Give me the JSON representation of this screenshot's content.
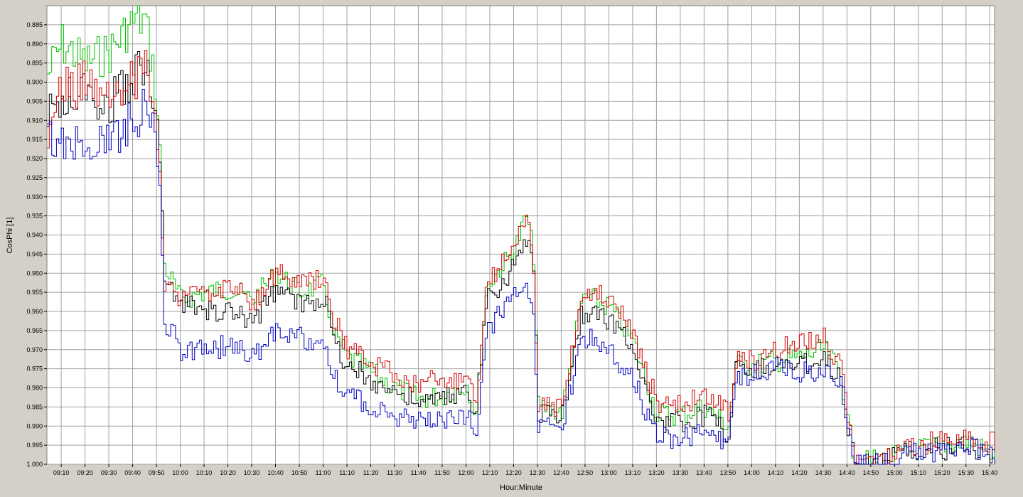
{
  "chart_data": {
    "type": "line",
    "xlabel": "Hour:Minute",
    "ylabel": "CosPhi [1]",
    "xlim": [
      "09:04",
      "15:42"
    ],
    "ylim": [
      0.88,
      1.0
    ],
    "y_reversed": true,
    "grid": true,
    "x_ticks": [
      "09:10",
      "09:20",
      "09:30",
      "09:40",
      "09:50",
      "10:00",
      "10:10",
      "10:20",
      "10:30",
      "10:40",
      "10:50",
      "11:00",
      "11:10",
      "11:20",
      "11:30",
      "11:40",
      "11:50",
      "12:00",
      "12:10",
      "12:20",
      "12:30",
      "12:40",
      "12:50",
      "13:00",
      "13:10",
      "13:20",
      "13:30",
      "13:40",
      "13:50",
      "14:00",
      "14:10",
      "14:20",
      "14:30",
      "14:40",
      "14:50",
      "15:00",
      "15:10",
      "15:20",
      "15:30",
      "15:40"
    ],
    "y_ticks": [
      "0.885",
      "0.890",
      "0.895",
      "0.900",
      "0.905",
      "0.910",
      "0.915",
      "0.920",
      "0.925",
      "0.930",
      "0.935",
      "0.940",
      "0.945",
      "0.950",
      "0.955",
      "0.960",
      "0.965",
      "0.970",
      "0.975",
      "0.980",
      "0.985",
      "0.990",
      "0.995",
      "1.000"
    ],
    "y_tick_values": [
      0.885,
      0.89,
      0.895,
      0.9,
      0.905,
      0.91,
      0.915,
      0.92,
      0.925,
      0.93,
      0.935,
      0.94,
      0.945,
      0.95,
      0.955,
      0.96,
      0.965,
      0.97,
      0.975,
      0.98,
      0.985,
      0.99,
      0.995,
      1.0
    ],
    "x": [
      "09:04",
      "09:10",
      "09:20",
      "09:30",
      "09:40",
      "09:45",
      "09:49",
      "09:51",
      "09:53",
      "10:00",
      "10:10",
      "10:20",
      "10:30",
      "10:40",
      "10:50",
      "11:00",
      "11:04",
      "11:10",
      "11:20",
      "11:30",
      "11:40",
      "11:50",
      "12:00",
      "12:04",
      "12:08",
      "12:10",
      "12:20",
      "12:25",
      "12:28",
      "12:30",
      "12:40",
      "12:48",
      "12:50",
      "13:00",
      "13:10",
      "13:20",
      "13:30",
      "13:40",
      "13:50",
      "13:53",
      "14:00",
      "14:10",
      "14:20",
      "14:30",
      "14:37",
      "14:40",
      "14:43",
      "14:50",
      "15:00",
      "15:10",
      "15:20",
      "15:30",
      "15:40",
      "15:42"
    ],
    "series": [
      {
        "color": "#00c000",
        "values": [
          0.898,
          0.89,
          0.895,
          0.892,
          0.884,
          0.884,
          0.9,
          0.918,
          0.948,
          0.957,
          0.955,
          0.954,
          0.957,
          0.95,
          0.955,
          0.953,
          0.966,
          0.972,
          0.976,
          0.98,
          0.983,
          0.982,
          0.979,
          0.987,
          0.955,
          0.952,
          0.944,
          0.935,
          0.945,
          0.985,
          0.986,
          0.958,
          0.956,
          0.959,
          0.968,
          0.987,
          0.987,
          0.985,
          0.99,
          0.974,
          0.974,
          0.973,
          0.972,
          0.97,
          0.976,
          0.989,
          1.0,
          0.999,
          0.998,
          0.996,
          0.995,
          0.994,
          0.997,
          0.997
        ]
      },
      {
        "color": "#000000",
        "values": [
          0.909,
          0.905,
          0.902,
          0.906,
          0.898,
          0.895,
          0.905,
          0.918,
          0.952,
          0.958,
          0.96,
          0.96,
          0.963,
          0.954,
          0.958,
          0.956,
          0.968,
          0.974,
          0.978,
          0.981,
          0.984,
          0.983,
          0.981,
          0.986,
          0.958,
          0.956,
          0.948,
          0.94,
          0.95,
          0.986,
          0.987,
          0.961,
          0.96,
          0.962,
          0.969,
          0.99,
          0.989,
          0.987,
          0.992,
          0.975,
          0.975,
          0.974,
          0.974,
          0.972,
          0.977,
          0.99,
          1.0,
          0.999,
          0.998,
          0.996,
          0.996,
          0.995,
          0.997,
          0.997
        ]
      },
      {
        "color": "#d00000",
        "values": [
          0.912,
          0.902,
          0.9,
          0.903,
          0.9,
          0.897,
          0.908,
          0.922,
          0.954,
          0.956,
          0.956,
          0.953,
          0.958,
          0.95,
          0.953,
          0.952,
          0.962,
          0.97,
          0.974,
          0.976,
          0.979,
          0.978,
          0.977,
          0.983,
          0.952,
          0.951,
          0.944,
          0.935,
          0.948,
          0.984,
          0.985,
          0.956,
          0.955,
          0.957,
          0.966,
          0.984,
          0.985,
          0.982,
          0.986,
          0.972,
          0.973,
          0.97,
          0.969,
          0.967,
          0.975,
          0.988,
          1.0,
          0.999,
          0.998,
          0.995,
          0.994,
          0.993,
          0.994,
          0.995
        ]
      },
      {
        "color": "#0000c0",
        "values": [
          0.915,
          0.918,
          0.914,
          0.915,
          0.91,
          0.906,
          0.915,
          0.927,
          0.962,
          0.97,
          0.97,
          0.969,
          0.972,
          0.965,
          0.967,
          0.968,
          0.977,
          0.982,
          0.985,
          0.987,
          0.989,
          0.988,
          0.988,
          0.991,
          0.965,
          0.964,
          0.956,
          0.95,
          0.962,
          0.99,
          0.99,
          0.968,
          0.967,
          0.97,
          0.978,
          0.993,
          0.993,
          0.992,
          0.995,
          0.977,
          0.977,
          0.975,
          0.976,
          0.975,
          0.978,
          0.991,
          1.0,
          1.0,
          0.999,
          0.997,
          0.997,
          0.996,
          0.997,
          0.998
        ]
      }
    ]
  }
}
